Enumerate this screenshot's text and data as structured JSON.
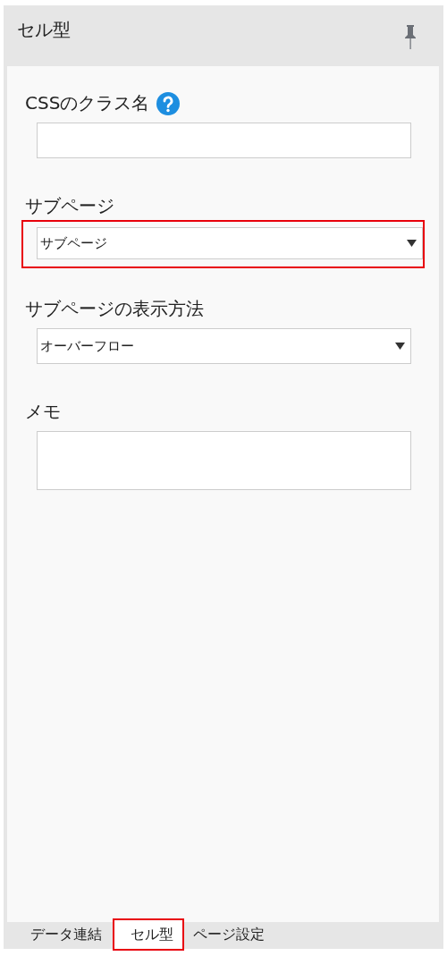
{
  "panel": {
    "title": "セル型"
  },
  "fields": [
    {
      "kind": "text",
      "label": "CSSのクラス名",
      "help": true,
      "highlighted": false
    },
    {
      "kind": "select",
      "label": "サブページ",
      "value": "サブページ",
      "highlighted": true
    },
    {
      "kind": "select",
      "label": "サブページの表示方法",
      "value": "オーバーフロー",
      "highlighted": false
    },
    {
      "kind": "textarea",
      "label": "メモ",
      "highlighted": false
    }
  ],
  "tabs": [
    {
      "label": "データ連結",
      "selected": false,
      "highlighted": false
    },
    {
      "label": "セル型",
      "selected": true,
      "highlighted": true
    },
    {
      "label": "ページ設定",
      "selected": false,
      "highlighted": false
    }
  ]
}
